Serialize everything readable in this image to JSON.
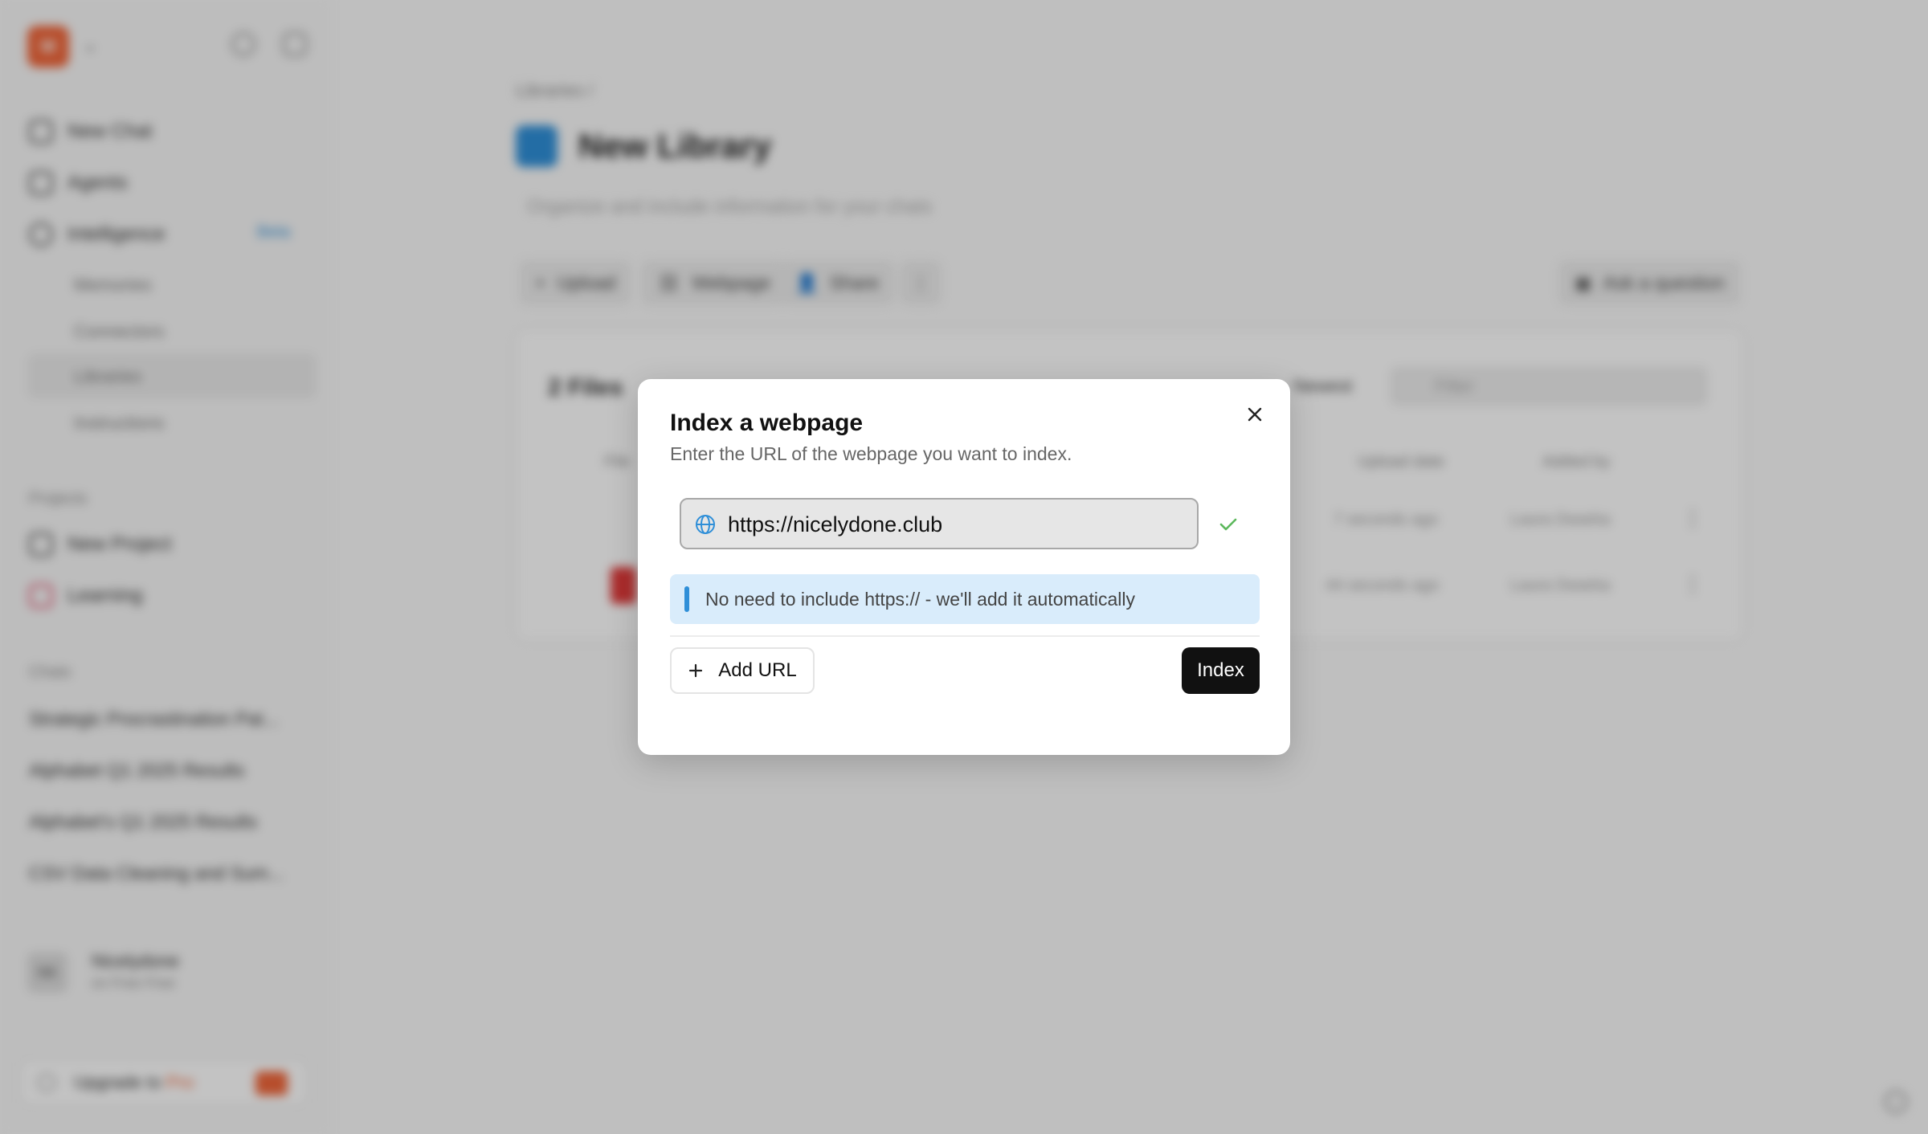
{
  "sidebar": {
    "logo_text": "M",
    "nav": {
      "new_chat": "New Chat",
      "agents": "Agents",
      "intelligence": "Intelligence",
      "beta_badge": "Beta"
    },
    "sub_items": [
      "Memories",
      "Connectors",
      "Libraries",
      "Instructions"
    ],
    "projects_label": "Projects",
    "projects": [
      "New Project",
      "Learning"
    ],
    "chats_label": "Chats",
    "chats": [
      "Strategic Procrastination Pat...",
      "Alphabet Q1 2025 Results",
      "Alphabet's Q1 2025 Results",
      "CSV Data Cleaning and Sum..."
    ],
    "user": {
      "initials": "NK",
      "name": "Nicelydone",
      "plan": "on Free Free"
    },
    "upgrade": {
      "prefix": "Upgrade to ",
      "highlight": "Pro"
    }
  },
  "main": {
    "breadcrumb": "Libraries /",
    "title": "New Library",
    "description": "Organize and include information for your chats",
    "toolbar": {
      "upload": "Upload",
      "webpage": "Webpage",
      "share": "Share",
      "ask": "Ask a question"
    },
    "files": {
      "count_label": "2 Files",
      "sort_label": "Newest",
      "filter_placeholder": "Filter",
      "columns": [
        "File",
        "Upload date",
        "Added by"
      ],
      "rows": [
        {
          "upload_date": "7 seconds ago",
          "added_by": "Laura Dwarka"
        },
        {
          "upload_date": "44 seconds ago",
          "added_by": "Laura Dwarka"
        }
      ]
    }
  },
  "modal": {
    "title": "Index a webpage",
    "subtitle": "Enter the URL of the webpage you want to index.",
    "url_value": "https://nicelydone.club",
    "info_note": "No need to include https:// - we'll add it automatically",
    "add_url_label": "Add URL",
    "index_label": "Index"
  },
  "colors": {
    "accent_blue": "#2f8fd8",
    "check_green": "#5cb85c",
    "primary_button": "#111111",
    "info_bg": "#d9ecfb",
    "logo_orange": "#f0663a"
  }
}
